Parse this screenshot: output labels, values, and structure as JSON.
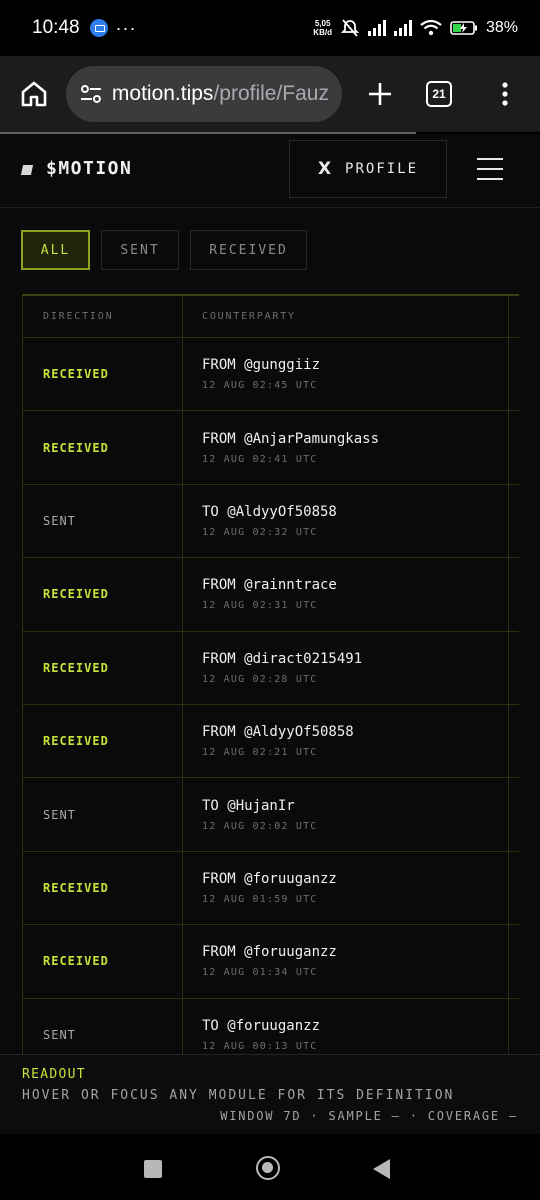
{
  "status_bar": {
    "time": "10:48",
    "net_speed_value": "5,05",
    "net_speed_unit": "KB/d",
    "battery": "38%",
    "icons": [
      "messenger-icon",
      "more-dots",
      "mute-icon",
      "signal-icon",
      "signal-icon",
      "wifi-icon",
      "battery-charging-icon"
    ]
  },
  "browser": {
    "url_host": "motion.tips",
    "url_path": "/profile/Fauz",
    "tab_count": "21",
    "icons": [
      "home-icon",
      "site-settings-icon",
      "new-tab-icon",
      "tab-switcher-icon",
      "more-menu-icon"
    ]
  },
  "site": {
    "brand": "$MOTION",
    "profile_button": "PROFILE",
    "profile_icon": "X",
    "accent_color": "#c6e23a"
  },
  "filters": [
    "ALL",
    "SENT",
    "RECEIVED"
  ],
  "filter_selected": "ALL",
  "table": {
    "headers": [
      "DIRECTION",
      "COUNTERPARTY"
    ],
    "rows": [
      {
        "direction": "RECEIVED",
        "counterparty": "FROM @gunggiiz",
        "time": "12 AUG 02:45 UTC"
      },
      {
        "direction": "RECEIVED",
        "counterparty": "FROM @AnjarPamungkass",
        "time": "12 AUG 02:41 UTC"
      },
      {
        "direction": "SENT",
        "counterparty": "TO @AldyyOf50858",
        "time": "12 AUG 02:32 UTC"
      },
      {
        "direction": "RECEIVED",
        "counterparty": "FROM @rainntrace",
        "time": "12 AUG 02:31 UTC"
      },
      {
        "direction": "RECEIVED",
        "counterparty": "FROM @diract0215491",
        "time": "12 AUG 02:28 UTC"
      },
      {
        "direction": "RECEIVED",
        "counterparty": "FROM @AldyyOf50858",
        "time": "12 AUG 02:21 UTC"
      },
      {
        "direction": "SENT",
        "counterparty": "TO @HujanIr",
        "time": "12 AUG 02:02 UTC"
      },
      {
        "direction": "RECEIVED",
        "counterparty": "FROM @foruuganzz",
        "time": "12 AUG 01:59 UTC"
      },
      {
        "direction": "RECEIVED",
        "counterparty": "FROM @foruuganzz",
        "time": "12 AUG 01:34 UTC"
      },
      {
        "direction": "SENT",
        "counterparty": "TO @foruuganzz",
        "time": "12 AUG 00:13 UTC"
      }
    ]
  },
  "readout": {
    "title": "READOUT",
    "text": "HOVER OR FOCUS ANY MODULE FOR ITS DEFINITION",
    "meta": "WINDOW 7D · SAMPLE — · COVERAGE —"
  },
  "nav_bar": {
    "icons": [
      "recents-icon",
      "home-icon",
      "back-icon"
    ]
  }
}
